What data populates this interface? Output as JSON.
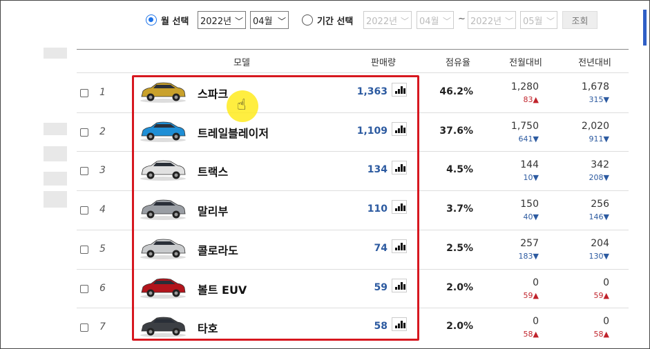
{
  "filters": {
    "month_radio_label": "월 선택",
    "month_year": "2022년",
    "month_month": "04월",
    "period_radio_label": "기간 선택",
    "period_from_year": "2022년",
    "period_from_month": "04월",
    "tilde": "~",
    "period_to_year": "2022년",
    "period_to_month": "05월",
    "search_button": "조회",
    "month_mode_selected": true
  },
  "table": {
    "headers": {
      "model": "모델",
      "sales": "판매량",
      "share": "점유율",
      "mom": "전월대비",
      "yoy": "전년대비"
    },
    "rows": [
      {
        "rank": "1",
        "model": "스파크",
        "car_color": "#c9a12b",
        "sales": "1,363",
        "share": "46.2%",
        "mom_value": "1,280",
        "mom_diff": "83",
        "mom_dir": "up",
        "yoy_value": "1,678",
        "yoy_diff": "315",
        "yoy_dir": "down"
      },
      {
        "rank": "2",
        "model": "트레일블레이저",
        "car_color": "#1f8fd6",
        "sales": "1,109",
        "share": "37.6%",
        "mom_value": "1,750",
        "mom_diff": "641",
        "mom_dir": "down",
        "yoy_value": "2,020",
        "yoy_diff": "911",
        "yoy_dir": "down"
      },
      {
        "rank": "3",
        "model": "트랙스",
        "car_color": "#e1e1e1",
        "sales": "134",
        "share": "4.5%",
        "mom_value": "144",
        "mom_diff": "10",
        "mom_dir": "down",
        "yoy_value": "342",
        "yoy_diff": "208",
        "yoy_dir": "down"
      },
      {
        "rank": "4",
        "model": "말리부",
        "car_color": "#9a9ea4",
        "sales": "110",
        "share": "3.7%",
        "mom_value": "150",
        "mom_diff": "40",
        "mom_dir": "down",
        "yoy_value": "256",
        "yoy_diff": "146",
        "yoy_dir": "down"
      },
      {
        "rank": "5",
        "model": "콜로라도",
        "car_color": "#c8cacc",
        "sales": "74",
        "share": "2.5%",
        "mom_value": "257",
        "mom_diff": "183",
        "mom_dir": "down",
        "yoy_value": "204",
        "yoy_diff": "130",
        "yoy_dir": "down"
      },
      {
        "rank": "6",
        "model": "볼트 EUV",
        "car_color": "#b3141c",
        "sales": "59",
        "share": "2.0%",
        "mom_value": "0",
        "mom_diff": "59",
        "mom_dir": "up",
        "yoy_value": "0",
        "yoy_diff": "59",
        "yoy_dir": "up"
      },
      {
        "rank": "7",
        "model": "타호",
        "car_color": "#3c3f44",
        "sales": "58",
        "share": "2.0%",
        "mom_value": "0",
        "mom_diff": "58",
        "mom_dir": "up",
        "yoy_value": "0",
        "yoy_diff": "58",
        "yoy_dir": "up"
      }
    ]
  },
  "icons": {
    "chart": "bar-chart-icon",
    "up": "▲",
    "down": "▼",
    "cursor": "pointer-hand-icon"
  },
  "colors": {
    "accent": "#1e73e8",
    "highlight_box": "#d7171f",
    "increase": "#c0232b",
    "decrease": "#2c5aa0"
  }
}
